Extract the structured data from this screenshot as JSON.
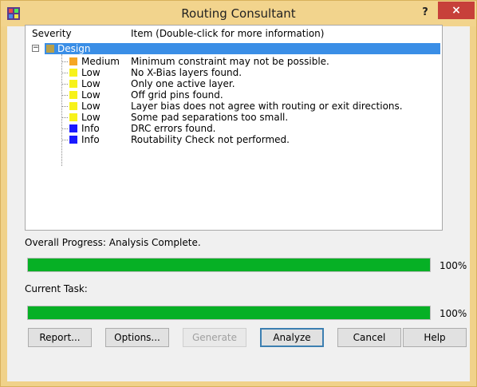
{
  "window": {
    "title": "Routing Consultant",
    "help_label": "?",
    "close_label": "×"
  },
  "list": {
    "columns": [
      "Severity",
      "Item (Double-click for more information)"
    ],
    "group": {
      "label": "Design",
      "expander": "−",
      "color": "#b9a04a"
    },
    "rows": [
      {
        "severity": "Medium",
        "item": "Minimum constraint may not be possible.",
        "color": "#f5a623"
      },
      {
        "severity": "Low",
        "item": "No X-Bias layers found.",
        "color": "#f7f21a"
      },
      {
        "severity": "Low",
        "item": "Only one active layer.",
        "color": "#f7f21a"
      },
      {
        "severity": "Low",
        "item": "Off grid pins found.",
        "color": "#f7f21a"
      },
      {
        "severity": "Low",
        "item": "Layer bias does not agree with routing or exit directions.",
        "color": "#f7f21a"
      },
      {
        "severity": "Low",
        "item": "Some pad separations too small.",
        "color": "#f7f21a"
      },
      {
        "severity": "Info",
        "item": "DRC errors found.",
        "color": "#1a1aff"
      },
      {
        "severity": "Info",
        "item": "Routability Check not performed.",
        "color": "#1a1aff"
      }
    ]
  },
  "progress": {
    "overall_label": "Overall Progress: Analysis Complete.",
    "overall_value": 100,
    "overall_text": "100%",
    "task_label": "Current Task:",
    "task_value": 100,
    "task_text": "100%"
  },
  "buttons": {
    "report": "Report...",
    "options": "Options...",
    "generate": "Generate",
    "analyze": "Analyze",
    "cancel": "Cancel",
    "help": "Help"
  },
  "colors": {
    "accent": "#3a8ee6",
    "progress": "#06b025",
    "titlebar": "#f2d48d",
    "close": "#c7403a"
  }
}
